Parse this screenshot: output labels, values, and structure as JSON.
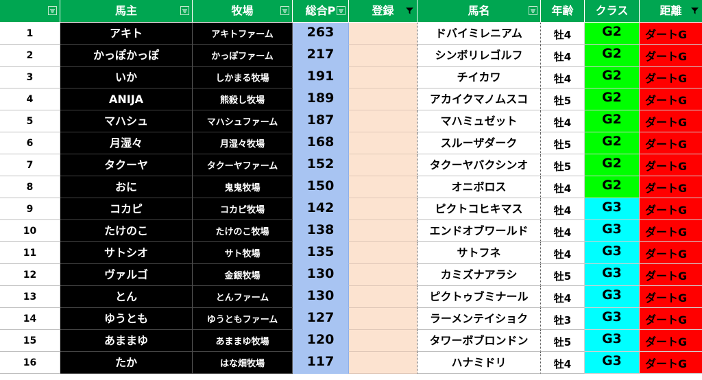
{
  "headers": [
    "",
    "馬主",
    "牧場",
    "総合P",
    "登録",
    "馬名",
    "年齢",
    "クラス",
    "距離"
  ],
  "colors": {
    "header_bg": "#00a651",
    "g2": "#00ff00",
    "g3": "#00ffff",
    "dist": "#ff0000",
    "points": "#a8c4f2",
    "registration": "#fce3d0"
  },
  "icons": {
    "filter": "filter-dropdown-icon",
    "filter_active": "filter-active-icon"
  },
  "rows": [
    {
      "num": "1",
      "owner": "アキト",
      "farm": "アキトファーム",
      "points": "263",
      "horse": "ドバイミレニアム",
      "age": "牡4",
      "cls": "G2",
      "dist": "ダートG"
    },
    {
      "num": "2",
      "owner": "かっぽかっぽ",
      "farm": "かっぽファーム",
      "points": "217",
      "horse": "シンボリレゴルフ",
      "age": "牡4",
      "cls": "G2",
      "dist": "ダートG"
    },
    {
      "num": "3",
      "owner": "いか",
      "farm": "しかまる牧場",
      "points": "191",
      "horse": "チイカワ",
      "age": "牡4",
      "cls": "G2",
      "dist": "ダートG"
    },
    {
      "num": "4",
      "owner": "ANIJA",
      "farm": "熊殺し牧場",
      "points": "189",
      "horse": "アカイクマノムスコ",
      "age": "牡5",
      "cls": "G2",
      "dist": "ダートG"
    },
    {
      "num": "5",
      "owner": "マハシュ",
      "farm": "マハシュファーム",
      "points": "187",
      "horse": "マハミュゼット",
      "age": "牡4",
      "cls": "G2",
      "dist": "ダートG"
    },
    {
      "num": "6",
      "owner": "月湿々",
      "farm": "月湿々牧場",
      "points": "168",
      "horse": "スルーザダーク",
      "age": "牡5",
      "cls": "G2",
      "dist": "ダートG"
    },
    {
      "num": "7",
      "owner": "タクーヤ",
      "farm": "タクーヤファーム",
      "points": "152",
      "horse": "タクーヤバクシンオ",
      "age": "牡5",
      "cls": "G2",
      "dist": "ダートG"
    },
    {
      "num": "8",
      "owner": "おに",
      "farm": "鬼鬼牧場",
      "points": "150",
      "horse": "オニボロス",
      "age": "牡4",
      "cls": "G2",
      "dist": "ダートG"
    },
    {
      "num": "9",
      "owner": "コカピ",
      "farm": "コカピ牧場",
      "points": "142",
      "horse": "ピクトコヒキマス",
      "age": "牡4",
      "cls": "G3",
      "dist": "ダートG"
    },
    {
      "num": "10",
      "owner": "たけのこ",
      "farm": "たけのこ牧場",
      "points": "138",
      "horse": "エンドオブワールド",
      "age": "牡4",
      "cls": "G3",
      "dist": "ダートG"
    },
    {
      "num": "11",
      "owner": "サトシオ",
      "farm": "サト牧場",
      "points": "135",
      "horse": "サトフネ",
      "age": "牡4",
      "cls": "G3",
      "dist": "ダートG"
    },
    {
      "num": "12",
      "owner": "ヴァルゴ",
      "farm": "金銀牧場",
      "points": "130",
      "horse": "カミズナアラシ",
      "age": "牡5",
      "cls": "G3",
      "dist": "ダートG"
    },
    {
      "num": "13",
      "owner": "とん",
      "farm": "とんファーム",
      "points": "130",
      "horse": "ピクトゥブミナール",
      "age": "牡4",
      "cls": "G3",
      "dist": "ダートG"
    },
    {
      "num": "14",
      "owner": "ゆうとも",
      "farm": "ゆうともファーム",
      "points": "127",
      "horse": "ラーメンテイショク",
      "age": "牡3",
      "cls": "G3",
      "dist": "ダートG"
    },
    {
      "num": "15",
      "owner": "あままゆ",
      "farm": "あままゆ牧場",
      "points": "120",
      "horse": "タワーボブロンドン",
      "age": "牡5",
      "cls": "G3",
      "dist": "ダートG"
    },
    {
      "num": "16",
      "owner": "たか",
      "farm": "はな畑牧場",
      "points": "117",
      "horse": "ハナミドリ",
      "age": "牡4",
      "cls": "G3",
      "dist": "ダートG"
    }
  ]
}
